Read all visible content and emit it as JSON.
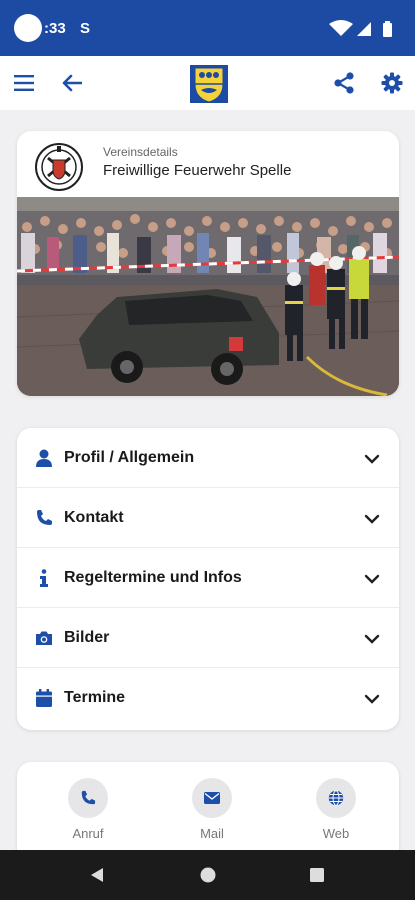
{
  "status_bar": {
    "time": ":33",
    "s_icon": "S"
  },
  "app_bar": {
    "menu_icon": "menu-icon",
    "back_icon": "arrow-left-icon",
    "share_icon": "share-icon",
    "settings_icon": "gear-icon"
  },
  "club": {
    "subtitle": "Vereinsdetails",
    "name": "Freiwillige Feuerwehr Spelle"
  },
  "menu": {
    "items": [
      {
        "label": "Profil / Allgemein",
        "icon": "user-icon"
      },
      {
        "label": "Kontakt",
        "icon": "phone-icon"
      },
      {
        "label": "Regeltermine und Infos",
        "icon": "info-icon"
      },
      {
        "label": "Bilder",
        "icon": "camera-icon"
      },
      {
        "label": "Termine",
        "icon": "calendar-icon"
      }
    ]
  },
  "actions": [
    {
      "label": "Anruf",
      "icon": "phone-icon"
    },
    {
      "label": "Mail",
      "icon": "mail-icon"
    },
    {
      "label": "Web",
      "icon": "globe-icon"
    }
  ],
  "colors": {
    "primary": "#1d4ba3",
    "icon": "#1e4fa8",
    "background": "#f0f0f2"
  }
}
